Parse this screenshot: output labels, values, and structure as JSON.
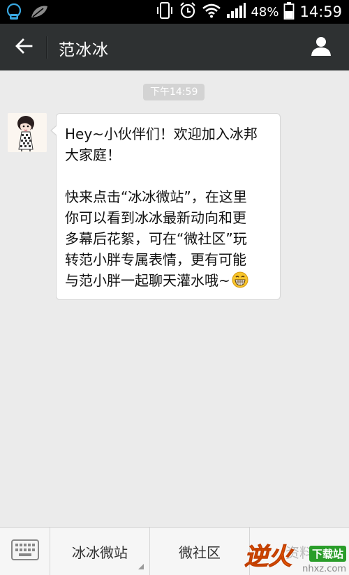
{
  "status_bar": {
    "battery_percent": "48%",
    "time": "14:59",
    "icons": [
      "notification-app-icon",
      "leaf-icon",
      "vibrate-icon",
      "alarm-icon",
      "wifi-icon",
      "signal-icon",
      "battery-icon"
    ]
  },
  "header": {
    "title": "范冰冰",
    "back_icon": "back-arrow-icon",
    "profile_icon": "user-profile-icon"
  },
  "chat": {
    "timestamp": "下午14:59",
    "message": {
      "line1": "Hey~小伙伴们！欢迎加入冰邦",
      "line2": "大家庭！",
      "line3": "快来点击“冰冰微站”，在这里",
      "line4": "你可以看到冰冰最新动向和更",
      "line5": "多幕后花絮，可在“微社区”玩",
      "line6": "转范小胖专属表情，更有可能",
      "line7": "与范小胖一起聊天灌水哦~",
      "emoji": "grinning-face-emoji"
    }
  },
  "bottom_menu": {
    "keyboard_icon": "keyboard-icon",
    "items": [
      {
        "label": "冰冰微站"
      },
      {
        "label": "微社区"
      },
      {
        "label": "资料"
      }
    ]
  },
  "watermark": {
    "logo_text": "逆火",
    "badge": "下载站",
    "url": "nhxz.com"
  }
}
